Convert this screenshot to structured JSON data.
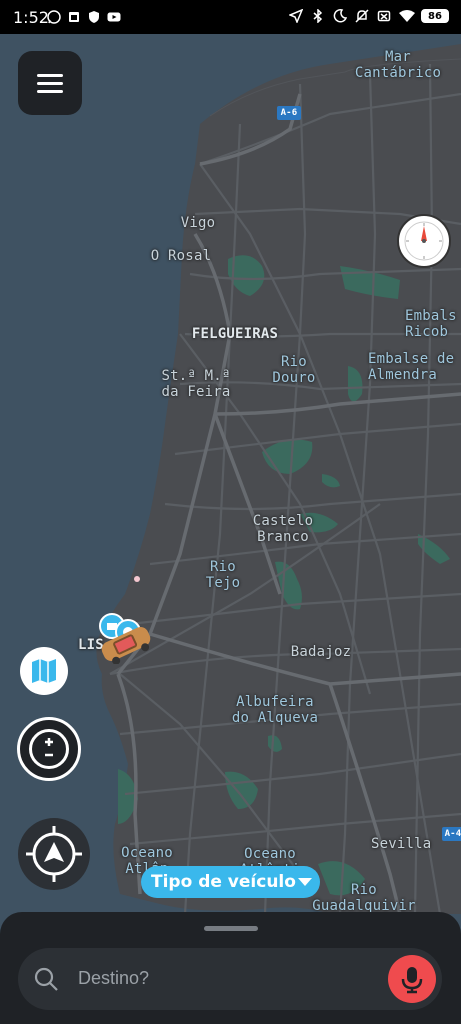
{
  "status_bar": {
    "time": "1:52",
    "battery": "86",
    "left_icons": [
      "whatsapp-icon",
      "sim-icon",
      "shield-icon",
      "youtube-icon"
    ],
    "right_icons": [
      "location-icon",
      "bluetooth-icon",
      "moon-icon",
      "mute-icon",
      "no-sim-icon",
      "wifi-icon",
      "battery-icon"
    ]
  },
  "map": {
    "labels": {
      "mar_cantabrico": "Mar\nCantábrico",
      "road_a6": "A-6",
      "vigo": "Vigo",
      "o_rosal": "O Rosal",
      "felgueiras": "FELGUEIRAS",
      "rio_douro": "Rio Douro",
      "embals_ricob": "Embals\nRicob",
      "embalse_almendra": "Embalse de\nAlmendra",
      "sta_maria_feira": "St.ª M.ª\nda Feira",
      "castelo_branco": "Castelo\nBranco",
      "rio_tejo": "Rio Tejo",
      "lisboa": "LIS",
      "badajoz": "Badajoz",
      "albufeira_alqueva": "Albufeira\ndo Alqueva",
      "oceano_atlantico_1": "Oceano\nAtlân",
      "oceano_atlantico_2": "Oceano\nAtlânti",
      "sevilla": "Sevilla",
      "road_a4": "A-4",
      "rio_guadalquivir": "Rio\nGuadalquivir"
    },
    "colors": {
      "water": "#3f5262",
      "land": "#4a4c50",
      "green": "#3b6a5e",
      "road": "#5a5e63"
    }
  },
  "controls": {
    "menu_icon": "hamburger-icon",
    "compass_icon": "compass-icon",
    "layers_icon": "map-layers-icon",
    "zoom_icon": "zoom-icon",
    "locate_icon": "locate-arrow-icon"
  },
  "vehicle_pill": {
    "label": "Tipo de veículo"
  },
  "search": {
    "placeholder": "Destino?",
    "search_icon": "search-icon",
    "mic_icon": "microphone-icon"
  },
  "accent_colors": {
    "pill": "#3ab8ec",
    "mic": "#ef4b4e",
    "surface": "#1f2226"
  }
}
